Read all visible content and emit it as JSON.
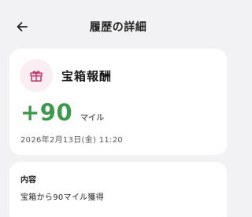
{
  "header": {
    "title": "履歴の詳細",
    "back_icon": "arrow-left-icon"
  },
  "reward": {
    "icon": "gift-icon",
    "icon_color": "#c2336a",
    "icon_bg": "#fbeef3",
    "title": "宝箱報酬",
    "amount": "+90",
    "amount_color": "#3c9a4c",
    "unit": "マイル",
    "timestamp": "2026年2月13日(金) 11:20"
  },
  "detail": {
    "label": "内容",
    "text": "宝箱から90マイル獲得"
  }
}
